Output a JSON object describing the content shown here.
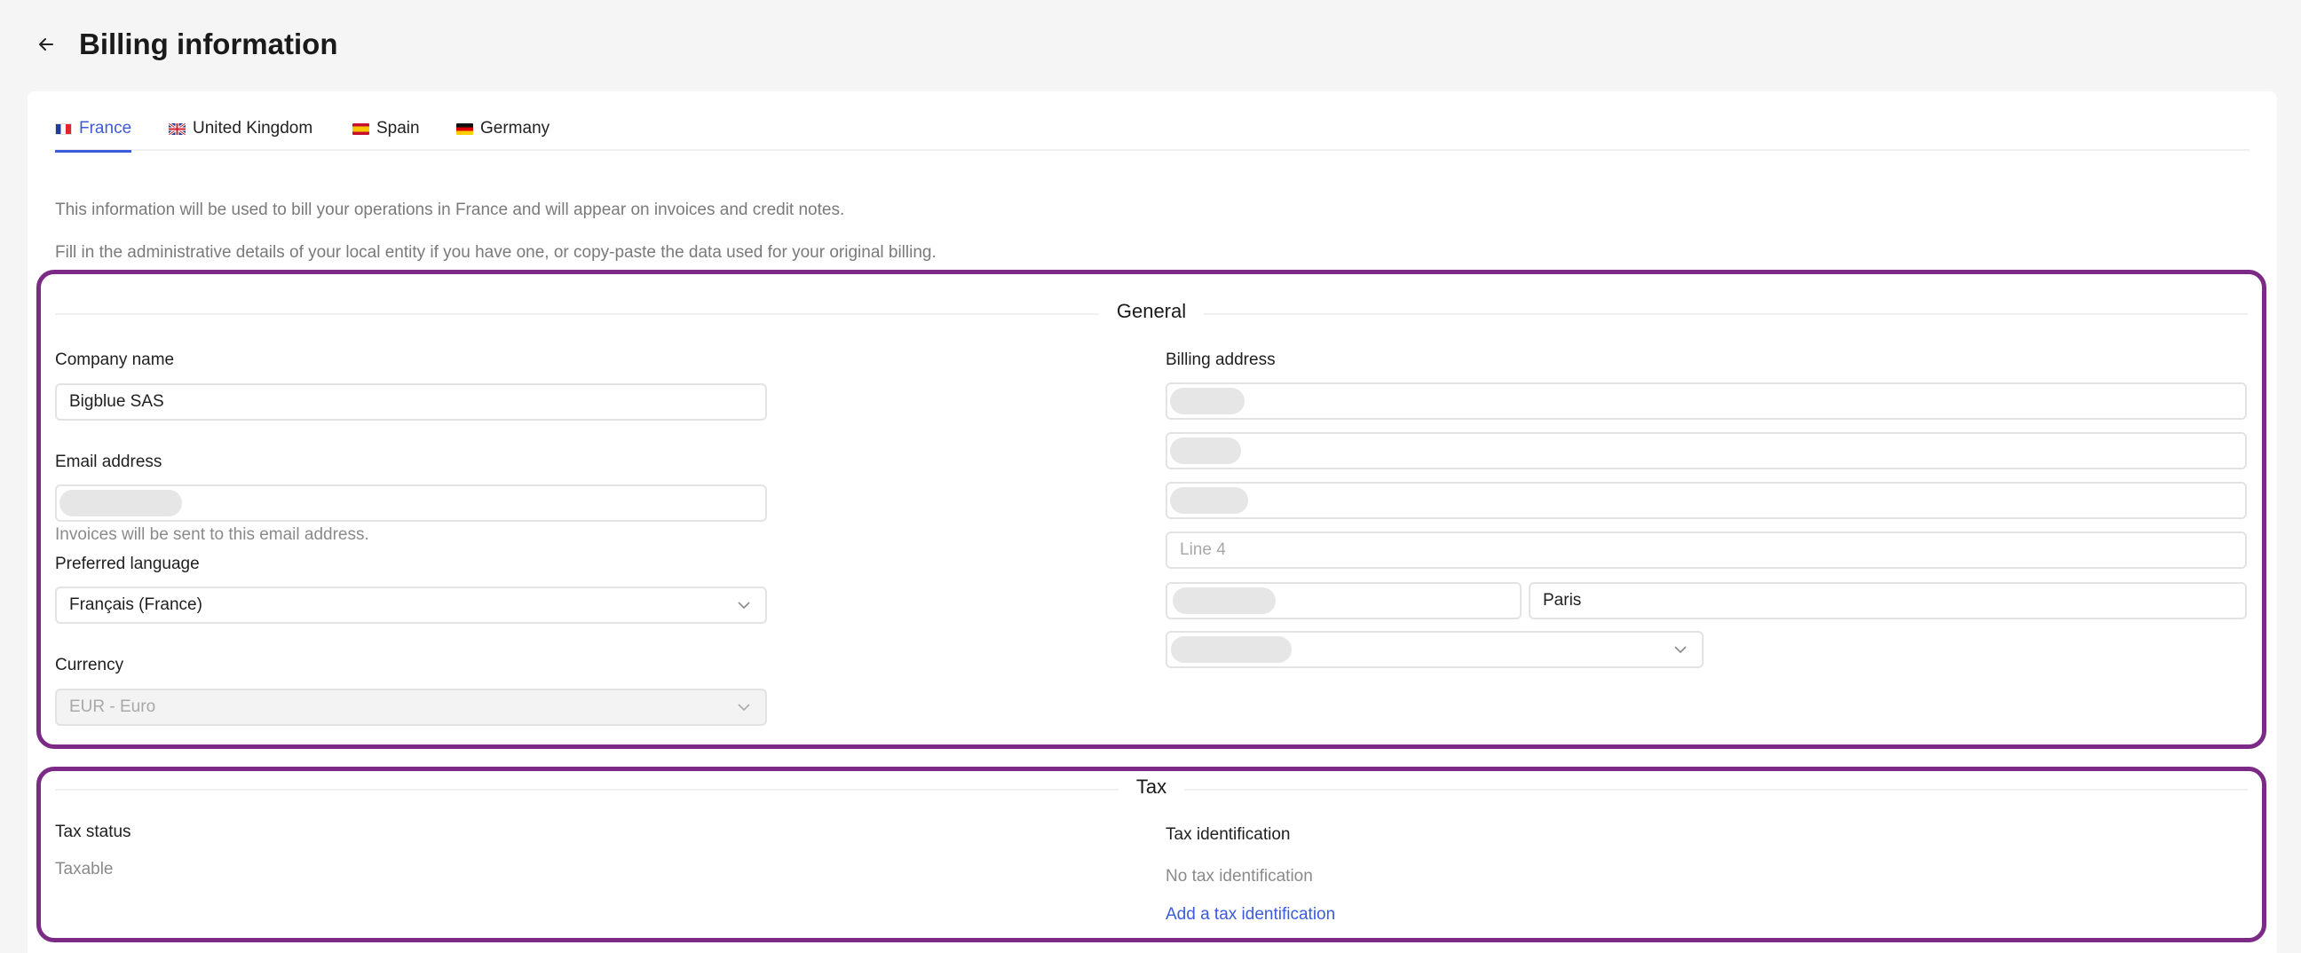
{
  "header": {
    "title": "Billing information"
  },
  "tabs": [
    {
      "label": "France",
      "active": true
    },
    {
      "label": "United Kingdom",
      "active": false
    },
    {
      "label": "Spain",
      "active": false
    },
    {
      "label": "Germany",
      "active": false
    }
  ],
  "intro": {
    "line1": "This information will be used to bill your operations in France and will appear on invoices and credit notes.",
    "line2": "Fill in the administrative details of your local entity if you have one, or copy-paste the data used for your original billing."
  },
  "general": {
    "title": "General",
    "company_name": {
      "label": "Company name",
      "value": "Bigblue SAS"
    },
    "email": {
      "label": "Email address",
      "helper": "Invoices will be sent to this email address."
    },
    "language": {
      "label": "Preferred language",
      "value": "Français (France)"
    },
    "currency": {
      "label": "Currency",
      "value": "EUR - Euro"
    },
    "billing_address": {
      "label": "Billing address",
      "line4_placeholder": "Line 4",
      "city": "Paris"
    }
  },
  "tax": {
    "title": "Tax",
    "status_label": "Tax status",
    "status_value": "Taxable",
    "identification_label": "Tax identification",
    "identification_value": "No tax identification",
    "add_link": "Add a tax identification"
  },
  "colors": {
    "accent": "#3b5bdb",
    "highlight_border": "#7b2a86"
  },
  "icons": {
    "back": "arrow-left-icon",
    "select": "chevron-down-icon"
  }
}
